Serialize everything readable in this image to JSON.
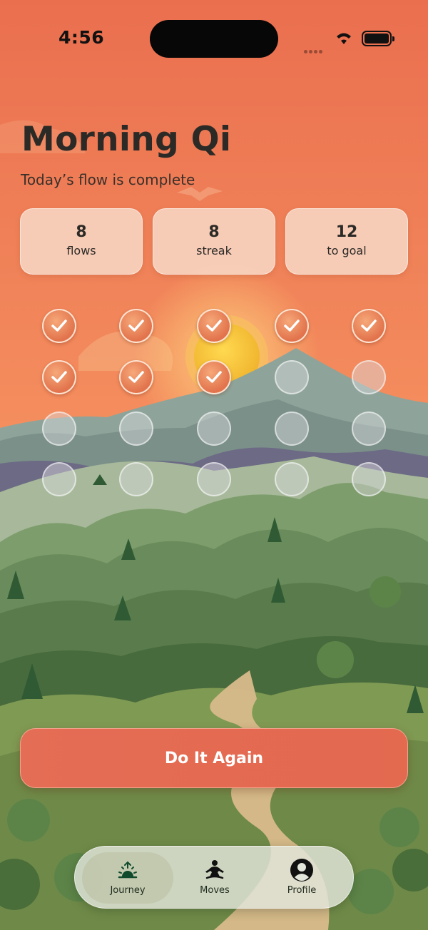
{
  "status_bar": {
    "time": "4:56"
  },
  "header": {
    "title": "Morning Qi",
    "subtitle": "Today’s flow is complete"
  },
  "stats": [
    {
      "value": "8",
      "label": "flows"
    },
    {
      "value": "8",
      "label": "streak"
    },
    {
      "value": "12",
      "label": "to goal"
    }
  ],
  "progress_grid": {
    "columns": 5,
    "rows": 4,
    "completed": 8,
    "total": 20,
    "cells": [
      "done",
      "done",
      "done",
      "done",
      "done",
      "done",
      "done",
      "done",
      "todo",
      "todo",
      "todo",
      "todo",
      "todo",
      "todo",
      "todo",
      "todo",
      "todo",
      "todo",
      "todo",
      "todo"
    ]
  },
  "cta": {
    "label": "Do It Again"
  },
  "tabbar": {
    "tabs": [
      {
        "label": "Journey",
        "icon": "sunrise-icon",
        "selected": true
      },
      {
        "label": "Moves",
        "icon": "meditation-icon",
        "selected": false
      },
      {
        "label": "Profile",
        "icon": "profile-icon",
        "selected": false
      }
    ]
  },
  "colors": {
    "accent": "#E46D55",
    "sky_top": "#EC7A57",
    "text_dark": "#2C2A26",
    "tab_green": "#0F4A2C"
  }
}
